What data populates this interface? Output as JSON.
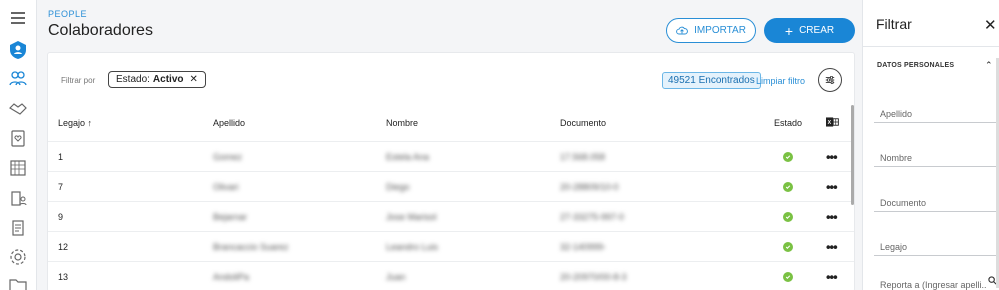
{
  "header": {
    "breadcrumb": "PEOPLE",
    "title": "Colaboradores",
    "import_label": "IMPORTAR",
    "create_label": "CREAR"
  },
  "filters": {
    "filter_by_label": "Filtrar por",
    "chip_key": "Estado:",
    "chip_value": "Activo",
    "found_label": "49521 Encontrados",
    "clear_label": "Limpiar filtro"
  },
  "table": {
    "headers": {
      "legajo": "Legajo",
      "apellido": "Apellido",
      "nombre": "Nombre",
      "documento": "Documento",
      "estado": "Estado"
    },
    "rows": [
      {
        "legajo": "1",
        "apellido": "Gomez",
        "nombre": "Estela Ana",
        "documento": "17.568.058"
      },
      {
        "legajo": "7",
        "apellido": "Olivari",
        "nombre": "Diego",
        "documento": "20-28809/10-0"
      },
      {
        "legajo": "9",
        "apellido": "Bejarnar",
        "nombre": "Jose Marisol",
        "documento": "27-33275-997-0"
      },
      {
        "legajo": "12",
        "apellido": "Brancaccio Suarez",
        "nombre": "Leandro Luis",
        "documento": "32-140999-"
      },
      {
        "legajo": "13",
        "apellido": "AndoliPa",
        "nombre": "Juan",
        "documento": "20-20970/00-8-3"
      }
    ]
  },
  "panel": {
    "title": "Filtrar",
    "section": "DATOS PERSONALES",
    "fields": {
      "apellido": "Apellido",
      "nombre": "Nombre",
      "documento": "Documento",
      "legajo": "Legajo",
      "reporta": "Reporta a (Ingresar apelli..."
    }
  },
  "colors": {
    "accent": "#1a86d6",
    "status_active": "#7ac143"
  }
}
